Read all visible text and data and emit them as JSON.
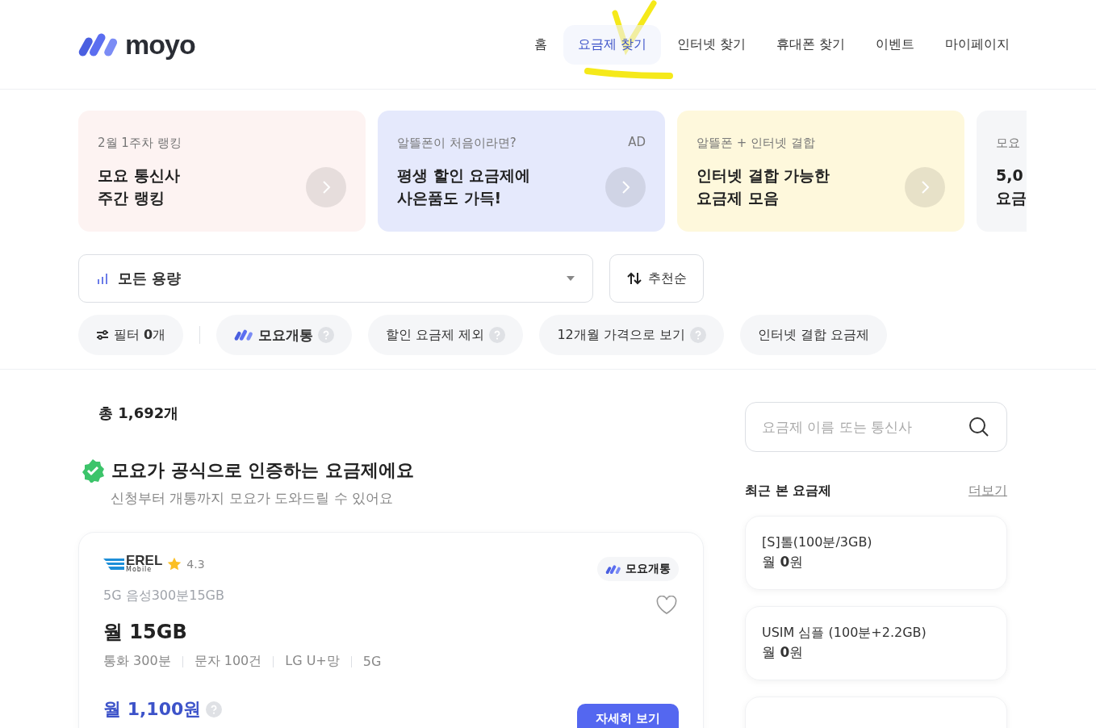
{
  "header": {
    "logo": "moyo",
    "nav": [
      {
        "label": "홈",
        "selected": false
      },
      {
        "label": "요금제 찾기",
        "selected": true
      },
      {
        "label": "인터넷 찾기",
        "selected": false
      },
      {
        "label": "휴대폰 찾기",
        "selected": false
      },
      {
        "label": "이벤트",
        "selected": false
      },
      {
        "label": "마이페이지",
        "selected": false
      }
    ]
  },
  "banners": [
    {
      "eyebrow": "2월 1주차 랭킹",
      "title": [
        "모요 통신사",
        "주간 랭킹"
      ],
      "color": "#fdf3f2"
    },
    {
      "eyebrow": "알뜰폰이 처음이라면?",
      "badge": "AD",
      "title": [
        "평생 할인 요금제에",
        "사은품도 가득!"
      ],
      "color": "#e5e9fc"
    },
    {
      "eyebrow": "알뜰폰 + 인터넷 결합",
      "title": [
        "인터넷 결합 가능한",
        "요금제 모음"
      ],
      "color": "#fef8dc"
    },
    {
      "eyebrow": "모요",
      "title": [
        "5,0",
        "요금"
      ],
      "color": "#f5f6f8"
    }
  ],
  "data_select": {
    "value": "모든 용량"
  },
  "sort_button": "추천순",
  "chips": [
    {
      "kind": "filter",
      "label": "필터 **0**개"
    },
    {
      "kind": "brand",
      "label": "모요개통",
      "help": true
    },
    {
      "kind": "plain",
      "label": "할인 요금제 제외",
      "help": true
    },
    {
      "kind": "plain",
      "label": "12개월 가격으로 보기",
      "help": true
    },
    {
      "kind": "plain",
      "label": "인터넷 결합 요금제",
      "help": false
    }
  ],
  "total": "총 1,692개",
  "certified": {
    "title": "모요가 공식으로 인증하는 요금제에요",
    "subtitle": "신청부터 개통까지 모요가 도와드릴 수 있어요"
  },
  "plan": {
    "provider_logo": "EREL",
    "provider_sub": "Mobile",
    "rating": "4.3",
    "badge": "모요개통",
    "liked": false,
    "name": "5G 음성300분15GB",
    "data": "월 15GB",
    "specs": [
      "통화 300분",
      "문자 100건",
      "LG U+망",
      "5G"
    ],
    "price": "월 1,100원",
    "button": "자세히 보기"
  },
  "search": {
    "placeholder": "요금제 이름 또는 통신사"
  },
  "recent": {
    "title": "최근 본 요금제",
    "more": "더보기",
    "items": [
      {
        "kind": "full",
        "name": "[S]톨(100분/3GB)",
        "price": "월 **0**원"
      },
      {
        "kind": "full",
        "name": "USIM 심플 (100분+2.2GB)",
        "price": "월 **0**원"
      },
      {
        "kind": "cut"
      }
    ]
  }
}
